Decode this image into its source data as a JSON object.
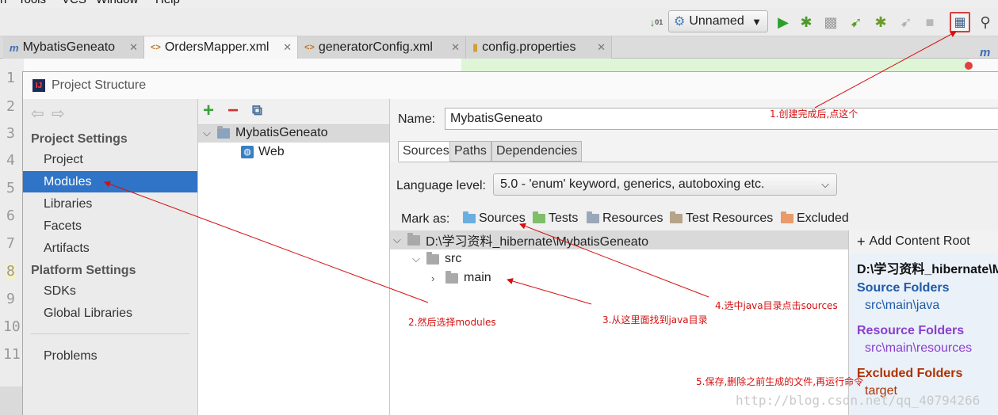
{
  "menubar": {
    "items": [
      "n",
      "Tools",
      "VCS",
      "Window",
      "Help"
    ]
  },
  "toolbar": {
    "run_config": "Unnamed",
    "icons": [
      "sort-icon",
      "run-icon",
      "debug-icon",
      "coverage-icon",
      "jrebel-run-icon",
      "jrebel-debug-icon",
      "build-icon",
      "stop-icon",
      "project-structure-icon",
      "search-icon"
    ]
  },
  "tabs": [
    {
      "label": "MybatisGeneato",
      "icon": "m"
    },
    {
      "label": "OrdersMapper.xml",
      "icon": "<>"
    },
    {
      "label": "generatorConfig.xml",
      "icon": "<>"
    },
    {
      "label": "config.properties",
      "icon": "▮"
    }
  ],
  "editor": {
    "line_numbers": [
      "1",
      "2",
      "3",
      "4",
      "5",
      "6",
      "7",
      "8",
      "9",
      "10",
      "11"
    ]
  },
  "dialog": {
    "title": "Project Structure",
    "project_settings_header": "Project Settings",
    "project_settings": [
      "Project",
      "Modules",
      "Libraries",
      "Facets",
      "Artifacts"
    ],
    "platform_settings_header": "Platform Settings",
    "platform_settings": [
      "SDKs",
      "Global Libraries"
    ],
    "problems": "Problems",
    "module_tree": {
      "module": "MybatisGeneato",
      "facet": "Web"
    },
    "name_label": "Name:",
    "name_value": "MybatisGeneato",
    "tabs": [
      "Sources",
      "Paths",
      "Dependencies"
    ],
    "language_level_label": "Language level:",
    "language_level_value": "5.0 - 'enum' keyword, generics, autoboxing etc.",
    "mark_as_label": "Mark as:",
    "mark_as": [
      {
        "label": "Sources",
        "color": "#6aaee0"
      },
      {
        "label": "Tests",
        "color": "#7fbf6a"
      },
      {
        "label": "Resources",
        "color": "#9aa7b8"
      },
      {
        "label": "Test Resources",
        "color": "#b5a38a"
      },
      {
        "label": "Excluded",
        "color": "#e89a6a"
      }
    ],
    "source_tree": {
      "root": "D:\\学习资料_hibernate\\MybatisGeneato",
      "src": "src",
      "main": "main"
    },
    "add_content_root": "Add Content Root",
    "content_root": "D:\\学习资料_hibernate\\M",
    "source_folders_header": "Source Folders",
    "source_folder": "src\\main\\java",
    "resource_folders_header": "Resource Folders",
    "resource_folder": "src\\main\\resources",
    "excluded_folders_header": "Excluded Folders",
    "excluded_folder": "target"
  },
  "annotations": {
    "step1": "1.创建完成后,点这个",
    "step2": "2.然后选择modules",
    "step3": "3.从这里面找到java目录",
    "step4": "4.选中java目录点击sources",
    "step5": "5.保存,删除之前生成的文件,再运行命令"
  },
  "watermark": "http://blog.csdn.net/qq_40794266",
  "colors": {
    "selection": "#2f74c6",
    "source_folder": "#1f5aa8",
    "resource_folder": "#8a3fcf",
    "excluded_folder": "#b03000",
    "annotation": "#d41010"
  }
}
